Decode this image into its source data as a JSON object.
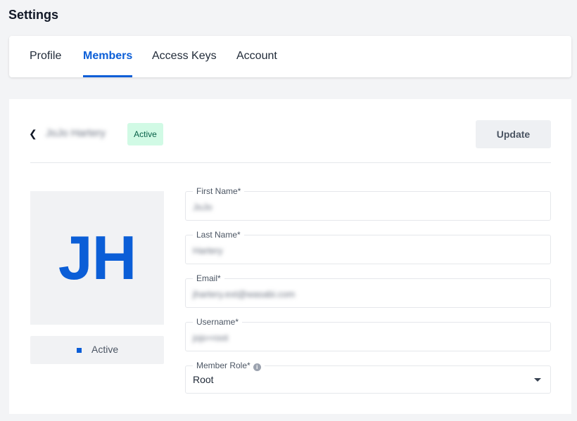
{
  "page": {
    "title": "Settings"
  },
  "tabs": [
    {
      "label": "Profile",
      "active": false
    },
    {
      "label": "Members",
      "active": true
    },
    {
      "label": "Access Keys",
      "active": false
    },
    {
      "label": "Account",
      "active": false
    }
  ],
  "member": {
    "name": "JoJo Hartery",
    "status_badge": "Active",
    "update_label": "Update",
    "avatar_initials": "JH",
    "status_label": "Active"
  },
  "form": {
    "first_name": {
      "label": "First Name*",
      "value": "JoJo"
    },
    "last_name": {
      "label": "Last Name*",
      "value": "Hartery"
    },
    "email": {
      "label": "Email*",
      "value": "jhartery.ext@wasabi.com"
    },
    "username": {
      "label": "Username*",
      "value": "jojo+root"
    },
    "member_role": {
      "label": "Member Role*",
      "value": "Root"
    }
  },
  "icons": {
    "back": "chevron-left-icon",
    "info": "info-icon",
    "dropdown": "chevron-down-icon"
  },
  "colors": {
    "accent": "#0b5ed7",
    "badge_bg": "#d1fae5",
    "background": "#f3f4f6"
  }
}
